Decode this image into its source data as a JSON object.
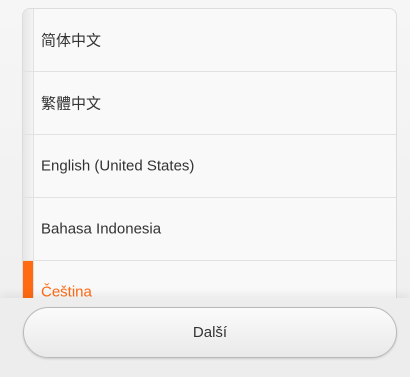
{
  "language_list": {
    "items": [
      {
        "label": "简体中文",
        "selected": false
      },
      {
        "label": "繁體中文",
        "selected": false
      },
      {
        "label": "English (United States)",
        "selected": false
      },
      {
        "label": "Bahasa Indonesia",
        "selected": false
      },
      {
        "label": "Čeština",
        "selected": true
      }
    ],
    "accent_color": "#ff6a13"
  },
  "footer": {
    "next_label": "Další"
  }
}
